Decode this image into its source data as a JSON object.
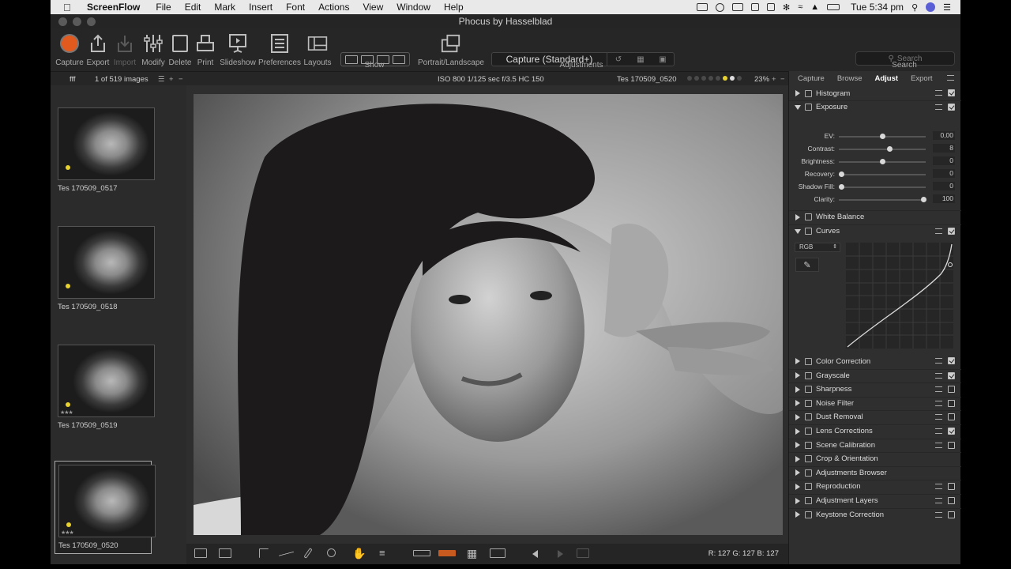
{
  "menubar": {
    "apple": "",
    "app_name": "ScreenFlow",
    "items": [
      "File",
      "Edit",
      "Mark",
      "Insert",
      "Font",
      "Actions",
      "View",
      "Window",
      "Help"
    ],
    "clock": "Tue 5:34 pm"
  },
  "window": {
    "title": "Phocus by Hasselblad"
  },
  "toolbar": {
    "buttons": [
      {
        "label": "Capture",
        "enabled": true
      },
      {
        "label": "Export",
        "enabled": true
      },
      {
        "label": "Import",
        "enabled": false
      },
      {
        "label": "Modify",
        "enabled": true
      },
      {
        "label": "Delete",
        "enabled": true
      },
      {
        "label": "Print",
        "enabled": true
      },
      {
        "label": "Slideshow",
        "enabled": true
      },
      {
        "label": "Preferences",
        "enabled": true
      },
      {
        "label": "Layouts",
        "enabled": true
      },
      {
        "label": "Portrait/Landscape",
        "enabled": true
      }
    ],
    "show_label": "Show",
    "adjustments_value": "Capture (Standard+)",
    "adjustments_label": "Adjustments",
    "search_placeholder": "Search",
    "search_label": "Search"
  },
  "infobar": {
    "folder": "fff",
    "image_count": "1 of 519 images",
    "exposure": "ISO 800  1/125 sec  f/3.5  HC 150",
    "filename": "Tes 170509_0520",
    "zoom": "23%",
    "rating_stars": 5
  },
  "browser": {
    "thumbnails": [
      {
        "name": "Tes 170509_0517",
        "label_color": "#e7d22f",
        "selected": false
      },
      {
        "name": "Tes 170509_0518",
        "label_color": "#e7d22f",
        "selected": false
      },
      {
        "name": "Tes 170509_0519",
        "label_color": "#e7d22f",
        "selected": false,
        "stars": "★★★"
      },
      {
        "name": "Tes 170509_0520",
        "label_color": "#e7d22f",
        "selected": true,
        "stars": "★★★"
      }
    ]
  },
  "bottombar": {
    "rgb": "R: 127  G: 127  B: 127"
  },
  "panel": {
    "tabs": [
      "Capture",
      "Browse",
      "Adjust",
      "Export"
    ],
    "active_tab": "Adjust",
    "tools_top": [
      {
        "label": "Histogram",
        "open": false,
        "checked": true
      },
      {
        "label": "Exposure",
        "open": true,
        "checked": true
      }
    ],
    "exposure_sliders": [
      {
        "label": "EV:",
        "value": "0,00",
        "pos": 0.5
      },
      {
        "label": "Contrast:",
        "value": "8",
        "pos": 0.58
      },
      {
        "label": "Brightness:",
        "value": "0",
        "pos": 0.5
      },
      {
        "label": "Recovery:",
        "value": "0",
        "pos": 0.03
      },
      {
        "label": "Shadow Fill:",
        "value": "0",
        "pos": 0.03
      },
      {
        "label": "Clarity:",
        "value": "100",
        "pos": 0.97
      }
    ],
    "white_balance": "White Balance",
    "curves": {
      "label": "Curves",
      "channel": "RGB"
    },
    "tools_bottom": [
      {
        "label": "Color Correction",
        "checked": true,
        "preset": true
      },
      {
        "label": "Grayscale",
        "checked": true,
        "preset": true
      },
      {
        "label": "Sharpness",
        "checked": false,
        "preset": true
      },
      {
        "label": "Noise Filter",
        "checked": false,
        "preset": true
      },
      {
        "label": "Dust Removal",
        "checked": false,
        "preset": true
      },
      {
        "label": "Lens Corrections",
        "checked": true,
        "preset": true
      },
      {
        "label": "Scene Calibration",
        "checked": false,
        "preset": true
      },
      {
        "label": "Crop & Orientation",
        "checked": null,
        "preset": false
      },
      {
        "label": "Adjustments Browser",
        "checked": null,
        "preset": false
      },
      {
        "label": "Reproduction",
        "checked": false,
        "preset": true
      },
      {
        "label": "Adjustment Layers",
        "checked": false,
        "preset": true
      },
      {
        "label": "Keystone Correction",
        "checked": false,
        "preset": true
      }
    ]
  }
}
